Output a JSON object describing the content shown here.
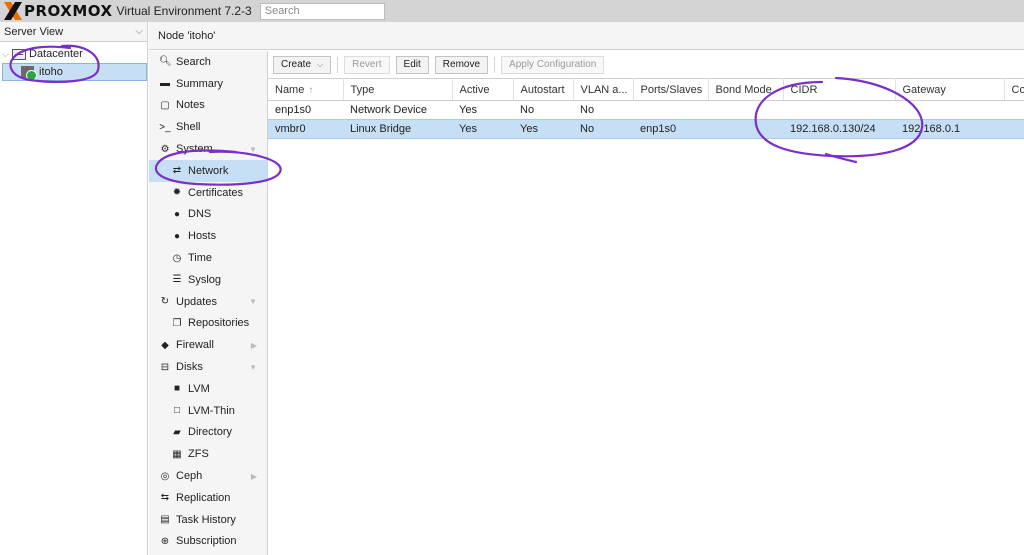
{
  "app": {
    "logo_brand": "PROXMOX",
    "product": "Virtual Environment 7.2-3",
    "search_placeholder": "Search"
  },
  "tree": {
    "view": "Server View",
    "datacenter": "Datacenter",
    "node": "itoho"
  },
  "header": {
    "title": "Node 'itoho'"
  },
  "menu": [
    {
      "label": "Search",
      "icon": "search-icon",
      "glyph": "🔍︎",
      "sub": false
    },
    {
      "label": "Summary",
      "icon": "book-icon",
      "glyph": "▬",
      "sub": false
    },
    {
      "label": "Notes",
      "icon": "notes-icon",
      "glyph": "▢",
      "sub": false
    },
    {
      "label": "Shell",
      "icon": "terminal-icon",
      "glyph": ">_",
      "sub": false
    },
    {
      "label": "System",
      "icon": "gears-icon",
      "glyph": "⚙",
      "sub": false,
      "arrow": "▼"
    },
    {
      "label": "Network",
      "icon": "exchange-icon",
      "glyph": "⇄",
      "sub": true,
      "selected": true
    },
    {
      "label": "Certificates",
      "icon": "certificate-icon",
      "glyph": "✹",
      "sub": true
    },
    {
      "label": "DNS",
      "icon": "globe-icon",
      "glyph": "●",
      "sub": true
    },
    {
      "label": "Hosts",
      "icon": "globe-icon",
      "glyph": "●",
      "sub": true
    },
    {
      "label": "Time",
      "icon": "clock-icon",
      "glyph": "◷",
      "sub": true
    },
    {
      "label": "Syslog",
      "icon": "list-icon",
      "glyph": "☰",
      "sub": true
    },
    {
      "label": "Updates",
      "icon": "refresh-icon",
      "glyph": "↻",
      "sub": false,
      "arrow": "▼"
    },
    {
      "label": "Repositories",
      "icon": "files-icon",
      "glyph": "❐",
      "sub": true
    },
    {
      "label": "Firewall",
      "icon": "shield-icon",
      "glyph": "◆",
      "sub": false,
      "arrow": "▶"
    },
    {
      "label": "Disks",
      "icon": "hdd-icon",
      "glyph": "⊟",
      "sub": false,
      "arrow": "▼"
    },
    {
      "label": "LVM",
      "icon": "square-icon",
      "glyph": "■",
      "sub": true
    },
    {
      "label": "LVM-Thin",
      "icon": "square-outline-icon",
      "glyph": "□",
      "sub": true
    },
    {
      "label": "Directory",
      "icon": "folder-icon",
      "glyph": "▰",
      "sub": true
    },
    {
      "label": "ZFS",
      "icon": "th-large-icon",
      "glyph": "▦",
      "sub": true
    },
    {
      "label": "Ceph",
      "icon": "ceph-icon",
      "glyph": "◎",
      "sub": false,
      "arrow": "▶"
    },
    {
      "label": "Replication",
      "icon": "retweet-icon",
      "glyph": "⇆",
      "sub": false
    },
    {
      "label": "Task History",
      "icon": "list-alt-icon",
      "glyph": "▤",
      "sub": false
    },
    {
      "label": "Subscription",
      "icon": "support-icon",
      "glyph": "⊕",
      "sub": false
    }
  ],
  "toolbar": {
    "create": "Create",
    "revert": "Revert",
    "edit": "Edit",
    "remove": "Remove",
    "apply": "Apply Configuration"
  },
  "table": {
    "columns": [
      "Name",
      "Type",
      "Active",
      "Autostart",
      "VLAN a...",
      "Ports/Slaves",
      "Bond Mode",
      "CIDR",
      "Gateway",
      "Co"
    ],
    "sort_indicator": "↑",
    "rows": [
      [
        "enp1s0",
        "Network Device",
        "Yes",
        "No",
        "No",
        "",
        "",
        "",
        "",
        ""
      ],
      [
        "vmbr0",
        "Linux Bridge",
        "Yes",
        "Yes",
        "No",
        "enp1s0",
        "",
        "192.168.0.130/24",
        "192.168.0.1",
        ""
      ]
    ],
    "selected_row": 1
  },
  "colors": {
    "accent": "#e57000",
    "selection": "#c7dff5",
    "annotation": "#7b2fc6"
  }
}
